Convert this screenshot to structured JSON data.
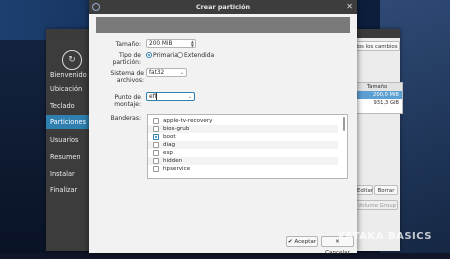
{
  "installer": {
    "sidebar": [
      "Bienvenido",
      "Ubicación",
      "Teclado",
      "Particiones",
      "Usuarios",
      "Resumen",
      "Instalar",
      "Finalizar"
    ],
    "active_index": 3,
    "revert_button": "dos los cambios",
    "table_header": "Tamaño",
    "table_rows": [
      "200,0 MiB",
      "931,3 GiB"
    ],
    "delete_button": "Borrar",
    "edit_button": "Editar",
    "disabled_button": "Volume Group"
  },
  "dialog": {
    "title": "Crear partición",
    "size_label": "Tamaño:",
    "size_value": "200 MiB",
    "type_label": "Tipo de partición:",
    "type_primary": "Primaria",
    "type_extended": "Extendida",
    "fs_label": "Sistema de archivos:",
    "fs_value": "fat32",
    "mount_label": "Punto de montaje:",
    "mount_value": "efi",
    "flags_label": "Banderas:",
    "flags": [
      {
        "name": "apple-tv-recovery",
        "checked": false
      },
      {
        "name": "bios-grub",
        "checked": false
      },
      {
        "name": "boot",
        "checked": true
      },
      {
        "name": "diag",
        "checked": false
      },
      {
        "name": "esp",
        "checked": false
      },
      {
        "name": "hidden",
        "checked": false
      },
      {
        "name": "hpservice",
        "checked": false
      }
    ],
    "accept_label": "Aceptar",
    "cancel_label": "Cancelar"
  },
  "watermark": "XATAKA BASICS",
  "colors": {
    "accent": "#2f7fb0",
    "titlebar": "#3d3d3d",
    "sidebar": "#3c3c3c"
  }
}
